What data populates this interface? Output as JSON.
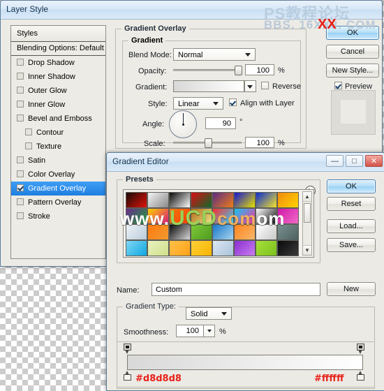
{
  "layer_style": {
    "title": "Layer Style",
    "styles_panel": {
      "header": "Styles",
      "blending_options": "Blending Options: Default",
      "items": [
        {
          "label": "Drop Shadow",
          "checked": false,
          "indent": false
        },
        {
          "label": "Inner Shadow",
          "checked": false,
          "indent": false
        },
        {
          "label": "Outer Glow",
          "checked": false,
          "indent": false
        },
        {
          "label": "Inner Glow",
          "checked": false,
          "indent": false
        },
        {
          "label": "Bevel and Emboss",
          "checked": false,
          "indent": false
        },
        {
          "label": "Contour",
          "checked": false,
          "indent": true
        },
        {
          "label": "Texture",
          "checked": false,
          "indent": true
        },
        {
          "label": "Satin",
          "checked": false,
          "indent": false
        },
        {
          "label": "Color Overlay",
          "checked": false,
          "indent": false
        },
        {
          "label": "Gradient Overlay",
          "checked": true,
          "indent": false,
          "selected": true
        },
        {
          "label": "Pattern Overlay",
          "checked": false,
          "indent": false
        },
        {
          "label": "Stroke",
          "checked": false,
          "indent": false
        }
      ]
    },
    "gradient_overlay": {
      "section_title": "Gradient Overlay",
      "group_title": "Gradient",
      "blend_mode_label": "Blend Mode:",
      "blend_mode_value": "Normal",
      "opacity_label": "Opacity:",
      "opacity_value": "100",
      "opacity_unit": "%",
      "gradient_label": "Gradient:",
      "reverse_label": "Reverse",
      "reverse_checked": false,
      "style_label": "Style:",
      "style_value": "Linear",
      "align_label": "Align with Layer",
      "align_checked": true,
      "angle_label": "Angle:",
      "angle_value": "90",
      "angle_unit": "°",
      "scale_label": "Scale:",
      "scale_value": "100",
      "scale_unit": "%"
    },
    "buttons": {
      "ok": "OK",
      "cancel": "Cancel",
      "new_style": "New Style...",
      "preview_label": "Preview",
      "preview_checked": true
    }
  },
  "gradient_editor": {
    "title": "Gradient Editor",
    "presets_label": "Presets",
    "name_label": "Name:",
    "name_value": "Custom",
    "gradient_type_label": "Gradient Type:",
    "gradient_type_value": "Solid",
    "smoothness_label": "Smoothness:",
    "smoothness_value": "100",
    "smoothness_unit": "%",
    "buttons": {
      "ok": "OK",
      "reset": "Reset",
      "load": "Load...",
      "save": "Save...",
      "new": "New"
    },
    "window_controls": {
      "minimize": "—",
      "maximize": "□",
      "close": "✕"
    },
    "stops": {
      "left_color": "#d8d8d8",
      "right_color": "#ffffff",
      "left_label": "#d8d8d8",
      "right_label": "#ffffff"
    },
    "preview_gradient": {
      "from": "#d8d8d8",
      "to": "#ffffff"
    },
    "presets_swatches": [
      [
        "#1a0b08",
        "#e01208"
      ],
      [
        "#f4f4f4",
        "#8a8a8a"
      ],
      [
        "#0a0a0a",
        "#fdfdfd"
      ],
      [
        "#d90d14",
        "#0f6b2a"
      ],
      [
        "#5a2c82",
        "#ef7c1a"
      ],
      [
        "#1414d2",
        "#e8e100"
      ],
      [
        "#0b2ed0",
        "#f5e32a"
      ],
      [
        "#f08a10",
        "#ffd400"
      ],
      [
        "#6a2b8e",
        "#1fa03a"
      ],
      [
        "#ffd000",
        "#d61a7a"
      ],
      [
        "#f27a10",
        "#ff3b00"
      ],
      [
        "#b06a14",
        "#efe08a"
      ],
      [
        "#ff2d2d",
        "#2dd3ff"
      ],
      [
        "#12c6f0",
        "#ff30a0"
      ],
      [
        "#ffffff",
        "#101010"
      ],
      [
        "#d018a8",
        "#f06cc8"
      ],
      [
        "#eef3f8",
        "#b8cbd8"
      ],
      [
        "#ff7a10",
        "#f09a30"
      ],
      [
        "#0a0a0a",
        "#d8d8d8"
      ],
      [
        "#7fc93b",
        "#4f9b1e"
      ],
      [
        "#1878c8",
        "#a9d4ee"
      ],
      [
        "#ff8420",
        "#f7b86a"
      ],
      [
        "#ffffff",
        "#c8c8c8"
      ],
      [
        "#78908f",
        "#4d6160"
      ],
      [
        "#7fd8f6",
        "#0fa6e0"
      ],
      [
        "#e8f2c0",
        "#cfe08a"
      ],
      [
        "#ffc24a",
        "#ffa018"
      ],
      [
        "#ffd23a",
        "#f7b200"
      ],
      [
        "#dce8f4",
        "#a8c2d8"
      ],
      [
        "#8a2fd0",
        "#c97cf0"
      ],
      [
        "#a8e03a",
        "#7bc01e"
      ],
      [
        "#0a0a0a",
        "#3a3a3a"
      ]
    ]
  },
  "watermarks": {
    "cn": "PS教程论坛",
    "bbs": "BBS. 16XX8. COM",
    "xx": "XX",
    "ucd_www": "www.",
    "ucd_u": "U",
    "ucd_c": "C",
    "ucd_d": "D",
    "ucd_com": "com",
    "ucd_tail": "om"
  }
}
